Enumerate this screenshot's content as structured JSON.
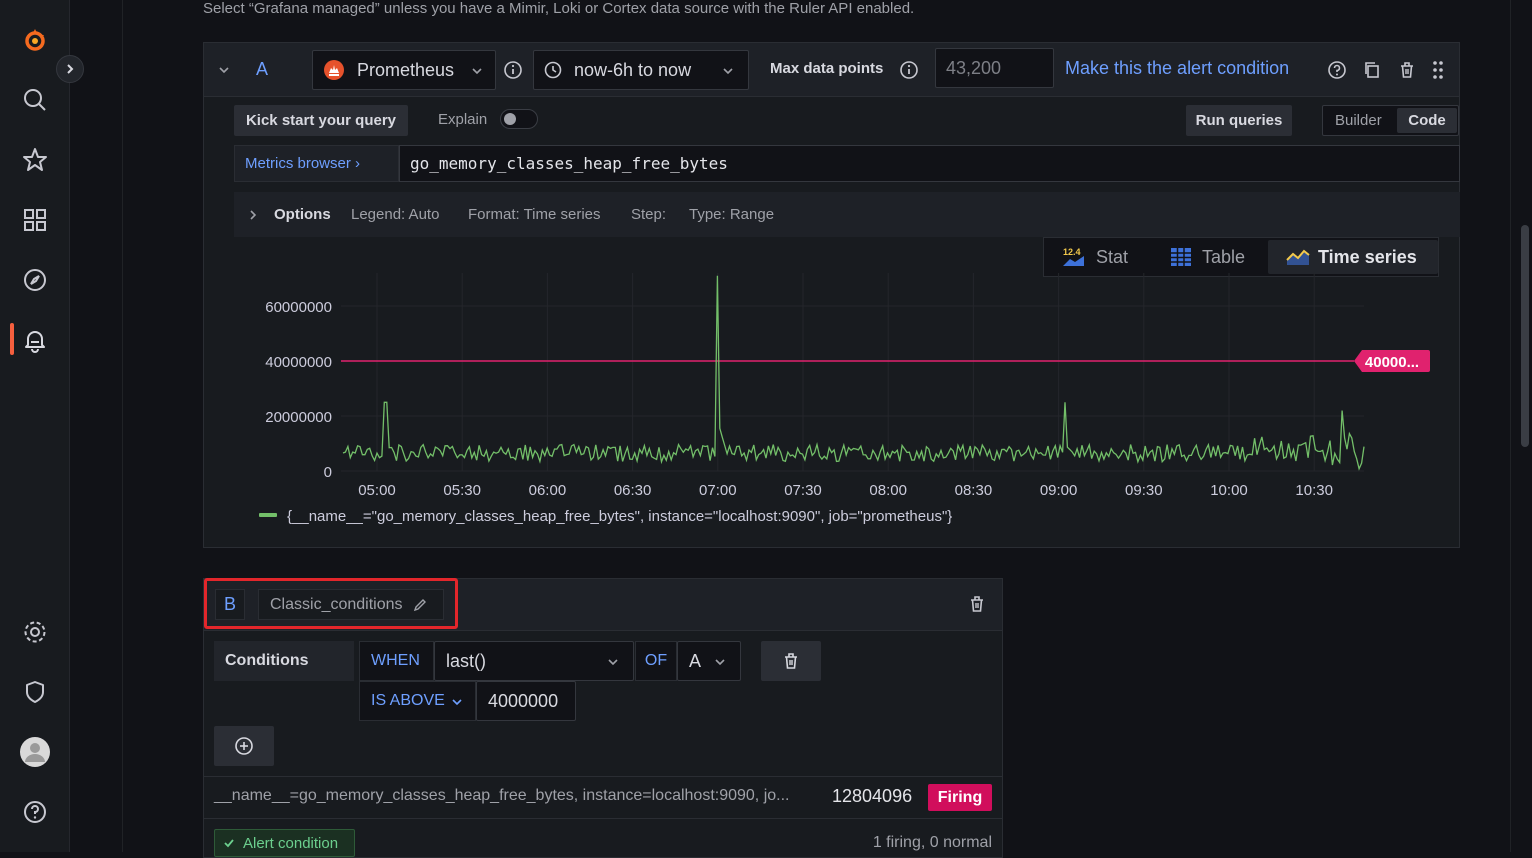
{
  "hint": "Select “Grafana managed” unless you have a Mimir, Loki or Cortex data source with the Ruler API enabled.",
  "sidebar": {
    "icons": [
      "grafana-logo-icon",
      "search-icon",
      "star-icon",
      "dashboards-icon",
      "explore-compass-icon",
      "alerting-bell-icon",
      "gear-icon",
      "shield-icon",
      "avatar",
      "help-icon"
    ],
    "accent": "#f55f3e"
  },
  "query_a": {
    "ref": "A",
    "datasource": "Prometheus",
    "time_range": "now-6h to now",
    "max_points_label": "Max data points",
    "max_points_placeholder": "43,200",
    "alert_condition_link": "Make this the alert condition",
    "kick_start": "Kick start your query",
    "explain_label": "Explain",
    "run_queries": "Run queries",
    "mode_builder": "Builder",
    "mode_code": "Code",
    "metrics_browser": "Metrics browser ›",
    "query": "go_memory_classes_heap_free_bytes",
    "options": {
      "label": "Options",
      "legend": "Legend: Auto",
      "format": "Format: Time series",
      "step": "Step:",
      "type": "Type: Range"
    },
    "viz_tabs": {
      "stat": "Stat",
      "table": "Table",
      "timeseries": "Time series",
      "stat_icon_text": "12.4"
    }
  },
  "chart_data": {
    "type": "line",
    "x_ticks": [
      "05:00",
      "05:30",
      "06:00",
      "06:30",
      "07:00",
      "07:30",
      "08:00",
      "08:30",
      "09:00",
      "09:30",
      "10:00",
      "10:30"
    ],
    "y_ticks": [
      "60000000",
      "40000000",
      "20000000",
      "0"
    ],
    "ylim": [
      0,
      72000000
    ],
    "threshold": 40000000,
    "threshold_label": "40000...",
    "threshold_color": "#e0226e",
    "series_color": "#73bf69",
    "legend": "{__name__=\"go_memory_classes_heap_free_bytes\", instance=\"localhost:9090\", job=\"prometheus\"}",
    "baseline": 6500000,
    "spikes": [
      {
        "x": "05:03",
        "y": 25000000
      },
      {
        "x": "07:00",
        "y": 71000000
      },
      {
        "x": "09:02",
        "y": 25000000
      },
      {
        "x": "10:40",
        "y": 22000000
      }
    ],
    "grid": true
  },
  "query_b": {
    "ref": "B",
    "name": "Classic_conditions",
    "conditions_label": "Conditions",
    "when": "WHEN",
    "reducer": "last()",
    "of": "OF",
    "query_ref": "A",
    "evaluator": "IS ABOVE",
    "threshold": "4000000",
    "result_label": "__name__=go_memory_classes_heap_free_bytes, instance=localhost:9090, jo...",
    "result_value": "12804096",
    "state": "Firing",
    "alert_condition": "Alert condition",
    "summary": "1 firing, 0 normal"
  }
}
